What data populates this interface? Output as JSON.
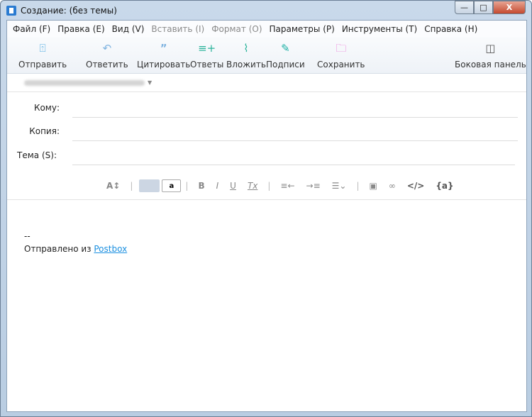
{
  "window": {
    "title": "Создание: (без темы)",
    "minimize": "—",
    "maximize": "□",
    "close": "X"
  },
  "menu": [
    {
      "label": "Файл (F)",
      "enabled": true
    },
    {
      "label": "Правка (E)",
      "enabled": true
    },
    {
      "label": "Вид (V)",
      "enabled": true
    },
    {
      "label": "Вставить (I)",
      "enabled": false
    },
    {
      "label": "Формат (O)",
      "enabled": false
    },
    {
      "label": "Параметры (P)",
      "enabled": true
    },
    {
      "label": "Инструменты (T)",
      "enabled": true
    },
    {
      "label": "Справка (H)",
      "enabled": true
    }
  ],
  "toolbar": {
    "send": "Отправить",
    "reply": "Ответить",
    "quote": "Цитировать",
    "responses": "Ответы",
    "attach": "Вложить",
    "signatures": "Подписи",
    "save": "Сохранить",
    "sidebar": "Боковая панель"
  },
  "fields": {
    "to": "Кому:",
    "cc": "Копия:",
    "subject": "Тема (S):"
  },
  "format": {
    "font_size": "A↕",
    "fg_sample": "a",
    "bold": "B",
    "italic": "I",
    "underline": "U",
    "clear": "Tx",
    "outdent": "≡←",
    "indent": "→≡",
    "list": "☰⌄",
    "image": "▣",
    "link": "∞",
    "code": "</>",
    "variable": "{a}"
  },
  "body": {
    "sig_sep": "--",
    "sent_from": "Отправлено из ",
    "link": "Postbox"
  },
  "colors": {
    "send": "#4aa8e0",
    "reply": "#7fb3e0",
    "responses": "#2ab39a",
    "signatures": "#1bb0a5",
    "save": "#e85bd0",
    "link": "#1a8fe0"
  }
}
